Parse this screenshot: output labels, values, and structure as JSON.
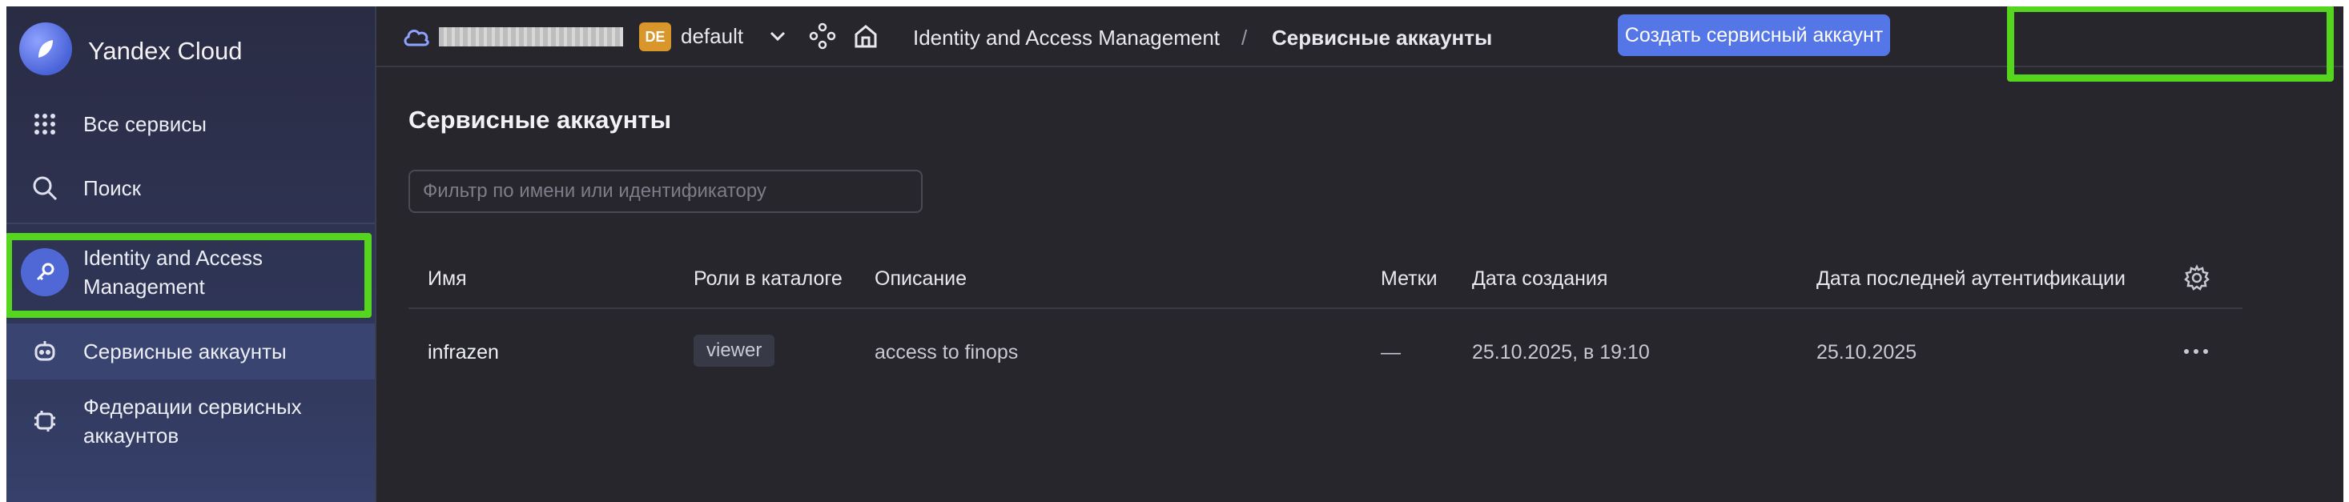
{
  "sidebar": {
    "brand": "Yandex Cloud",
    "items": [
      {
        "label": "Все сервисы",
        "icon": "grid-icon"
      },
      {
        "label": "Поиск",
        "icon": "search-icon"
      },
      {
        "label": "Identity and Access Management",
        "icon": "key-icon"
      },
      {
        "label": "Сервисные аккаунты",
        "icon": "robot-icon"
      },
      {
        "label": "Федерации сервисных аккаунтов",
        "icon": "federation-icon"
      }
    ]
  },
  "header": {
    "folder_badge": "DE",
    "folder": "default",
    "breadcrumb": [
      "Identity and Access Management",
      "Сервисные аккаунты"
    ],
    "separator": "/",
    "create_button": "Создать сервисный аккаунт"
  },
  "main": {
    "title": "Сервисные аккаунты",
    "filter_placeholder": "Фильтр по имени или идентификатору",
    "columns": [
      "Имя",
      "Роли в каталоге",
      "Описание",
      "Метки",
      "Дата создания",
      "Дата последней аутентификации"
    ],
    "rows": [
      {
        "name": "infrazen",
        "role": "viewer",
        "description": "access to finops",
        "labels": "—",
        "created": "25.10.2025, в 19:10",
        "last_auth": "25.10.2025"
      }
    ]
  },
  "colors": {
    "accent": "#5476e6",
    "highlight": "#56d51e",
    "background": "#27262d"
  }
}
